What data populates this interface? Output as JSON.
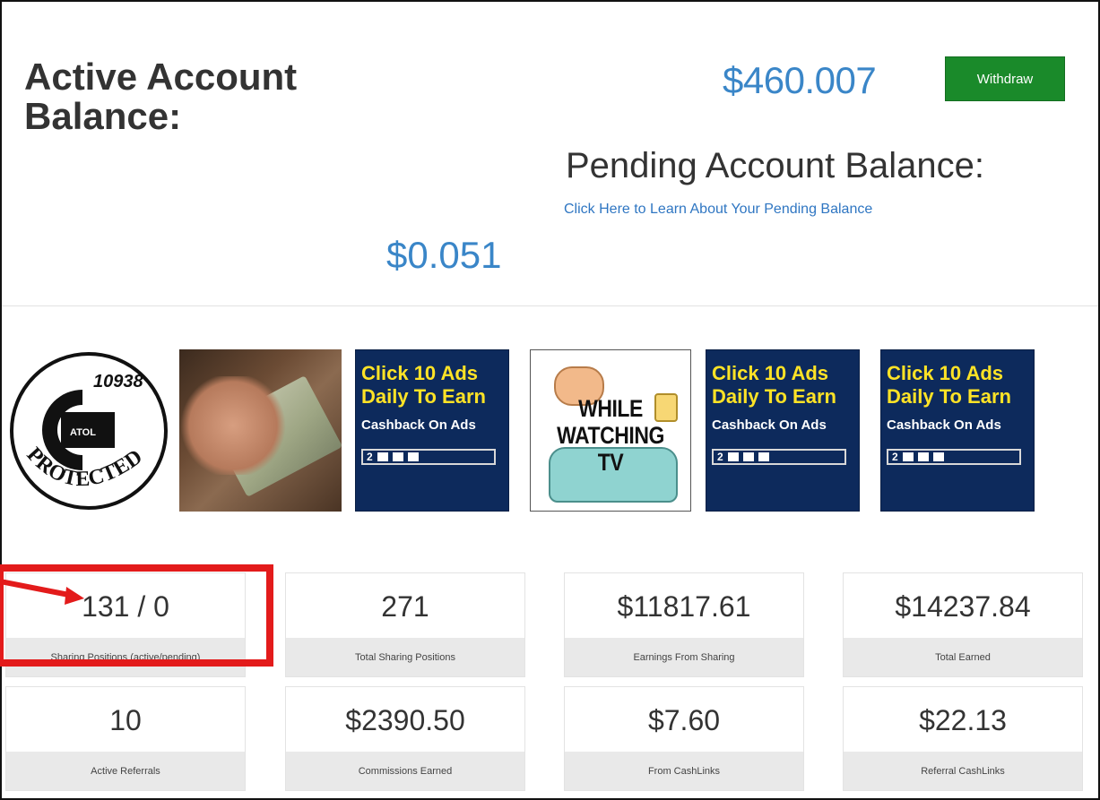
{
  "active_balance": {
    "title": "Active Account Balance:",
    "amount": "$460.007",
    "withdraw_label": "Withdraw"
  },
  "pending_balance": {
    "title": "Pending Account Balance:",
    "link": "Click Here to Learn About Your Pending Balance",
    "amount": "$0.051"
  },
  "badges": {
    "atol": {
      "number": "10938",
      "brand": "ATOL",
      "text": "PROTECTED"
    },
    "ad": {
      "line1": "Click 10 Ads",
      "line2": "Daily To Earn",
      "line3": "Cashback On Ads",
      "counter": "2"
    },
    "tv": {
      "line1": "WHILE",
      "line2": "WATCHING",
      "line3": "TV"
    }
  },
  "stats": [
    {
      "value": "131 / 0",
      "label": "Sharing Positions (active/pending)"
    },
    {
      "value": "271",
      "label": "Total Sharing Positions"
    },
    {
      "value": "$11817.61",
      "label": "Earnings From Sharing"
    },
    {
      "value": "$14237.84",
      "label": "Total Earned"
    },
    {
      "value": "10",
      "label": "Active Referrals"
    },
    {
      "value": "$2390.50",
      "label": "Commissions Earned"
    },
    {
      "value": "$7.60",
      "label": "From CashLinks"
    },
    {
      "value": "$22.13",
      "label": "Referral CashLinks"
    }
  ],
  "colors": {
    "balance": "#3a86c8",
    "withdraw": "#1a8a2a",
    "ad_bg": "#0d2a5c",
    "ad_text": "#ffe326",
    "highlight": "#e31b1b"
  }
}
